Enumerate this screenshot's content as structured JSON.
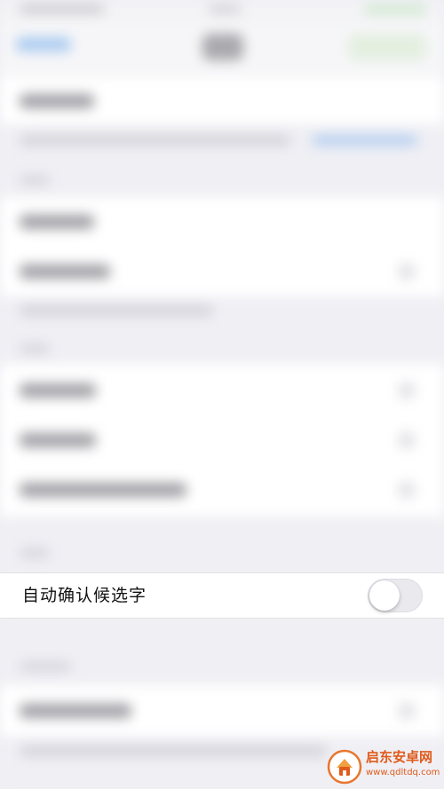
{
  "setting_row": {
    "label": "自动确认候选字",
    "toggle_on": false
  },
  "colors": {
    "background": "#efeff4",
    "row_background": "#ffffff",
    "label": "#111111",
    "toggle_off_track": "#e9e9ee",
    "watermark": "#e05a1a"
  },
  "icons": {
    "watermark_logo": "qidian-app-logo-icon"
  },
  "watermark": {
    "title": "启东安卓网",
    "url": "www.qdltdq.com"
  }
}
